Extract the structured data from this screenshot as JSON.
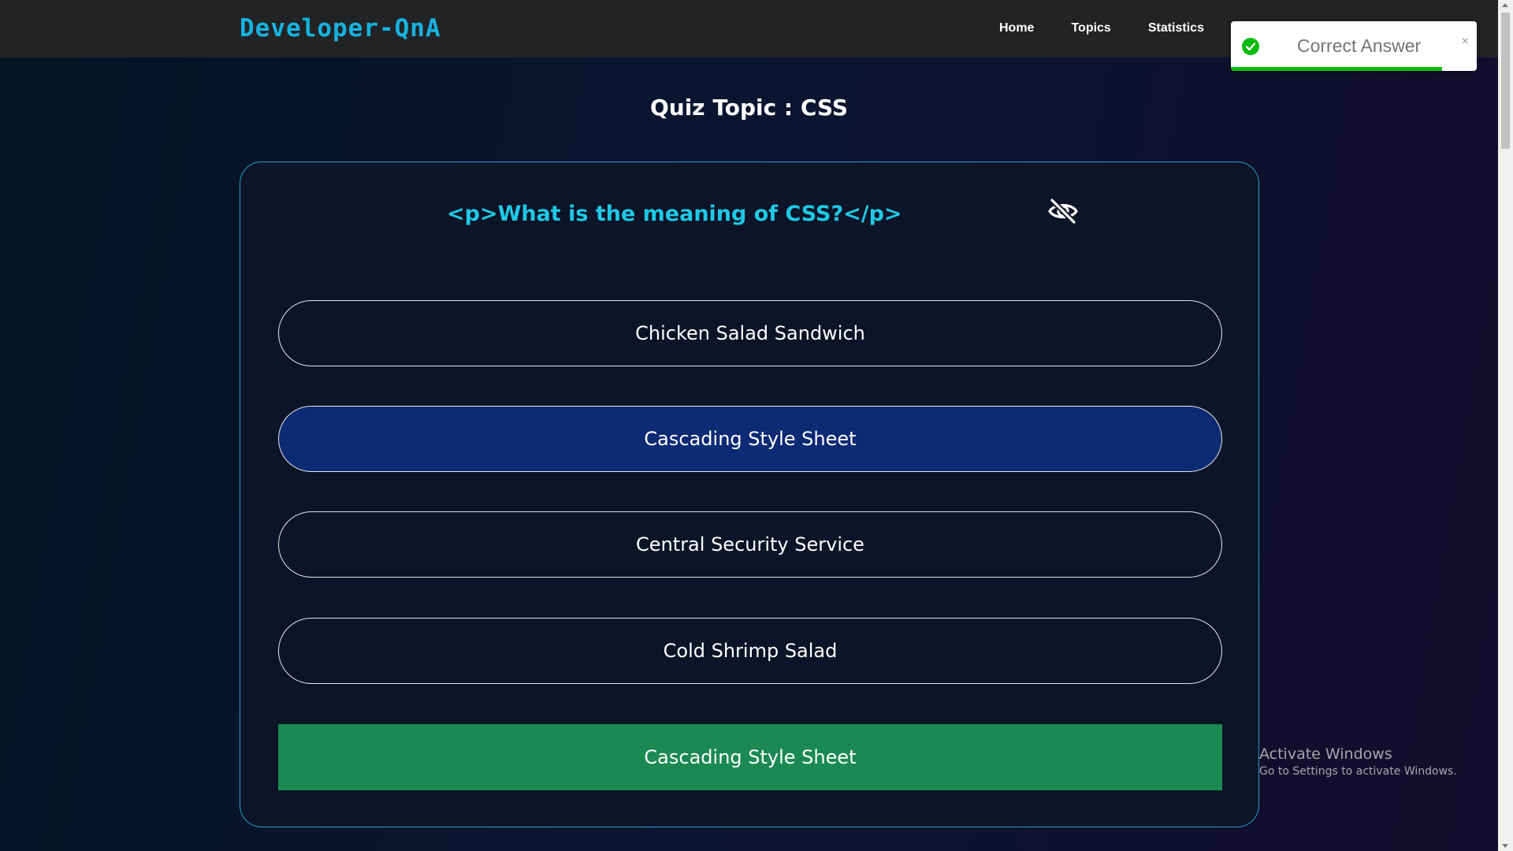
{
  "navbar": {
    "brand": "Developer-QnA",
    "links": [
      "Home",
      "Topics",
      "Statistics"
    ]
  },
  "toast": {
    "message": "Correct Answer",
    "close": "×",
    "icon": "check-circle-icon",
    "color": "#07bc0c",
    "progress": 0.86
  },
  "quiz": {
    "title": "Quiz Topic : CSS",
    "question": "<p>What is the meaning of CSS?</p>",
    "toggle_icon": "eye-slash-icon",
    "options": [
      "Chicken Salad Sandwich",
      "Cascading Style Sheet",
      "Central Security Service",
      "Cold Shrimp Salad"
    ],
    "selected_index": 1,
    "correct_answer": "Cascading Style Sheet",
    "selected_color": "#0d2a74",
    "answer_color": "#1a8a52",
    "accent_color": "#1fc8e6"
  },
  "watermark": {
    "title": "Activate Windows",
    "subtitle": "Go to Settings to activate Windows."
  }
}
